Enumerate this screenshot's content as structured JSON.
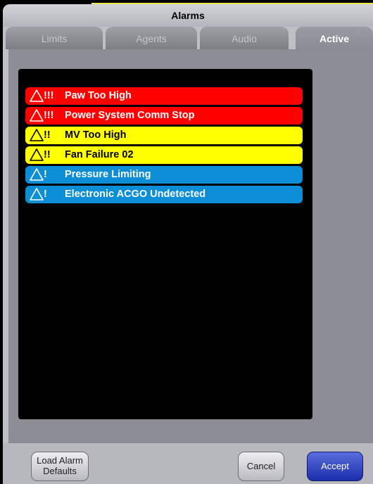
{
  "window": {
    "title": "Alarms"
  },
  "tabs": [
    {
      "label": "Limits",
      "active": false
    },
    {
      "label": "Agents",
      "active": false
    },
    {
      "label": "Audio",
      "active": false
    },
    {
      "label": "Active",
      "active": true
    }
  ],
  "alarms": [
    {
      "priority": "!!!",
      "text": "Paw Too High",
      "level": "high",
      "color": "#ff0000"
    },
    {
      "priority": "!!!",
      "text": "Power System Comm Stop",
      "level": "high",
      "color": "#ff0000"
    },
    {
      "priority": "!!",
      "text": "MV Too High",
      "level": "medium",
      "color": "#ffff00"
    },
    {
      "priority": "!!",
      "text": "Fan Failure 02",
      "level": "medium",
      "color": "#ffff00"
    },
    {
      "priority": "!",
      "text": "Pressure Limiting",
      "level": "low",
      "color": "#0c8ed6"
    },
    {
      "priority": "!",
      "text": "Electronic ACGO Undetected",
      "level": "low",
      "color": "#0c8ed6"
    }
  ],
  "buttons": {
    "load_defaults_line1": "Load Alarm",
    "load_defaults_line2": "Defaults",
    "cancel": "Cancel",
    "accept": "Accept"
  },
  "icons": {
    "alarm": "warning-triangle-icon"
  }
}
